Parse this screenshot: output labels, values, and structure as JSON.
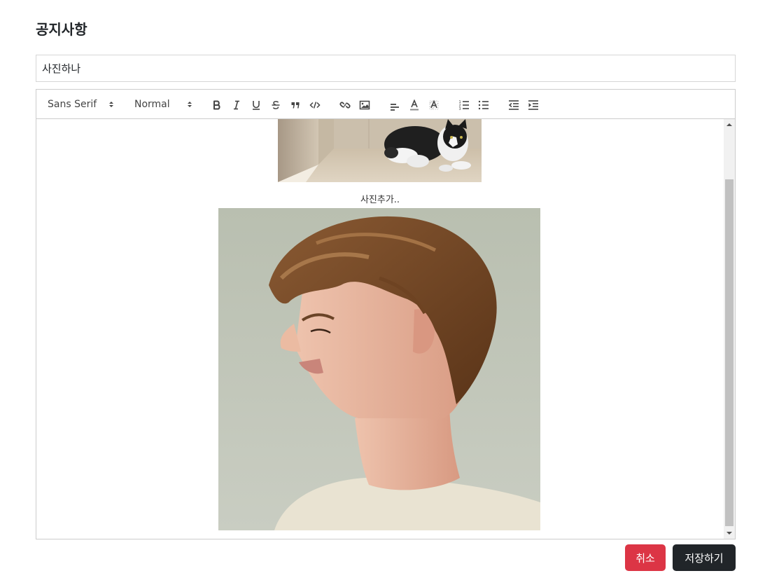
{
  "page": {
    "title": "공지사항"
  },
  "post": {
    "title_value": "사진하나"
  },
  "toolbar": {
    "font_picker": "Sans Serif",
    "size_picker": "Normal",
    "buttons": [
      {
        "icon": "bold-icon"
      },
      {
        "icon": "italic-icon"
      },
      {
        "icon": "underline-icon"
      },
      {
        "icon": "strikethrough-icon"
      },
      {
        "icon": "blockquote-icon"
      },
      {
        "icon": "code-block-icon"
      },
      {
        "icon": "link-icon"
      },
      {
        "icon": "image-icon"
      },
      {
        "icon": "align-icon"
      },
      {
        "icon": "text-color-icon"
      },
      {
        "icon": "background-color-icon"
      },
      {
        "icon": "ordered-list-icon"
      },
      {
        "icon": "bullet-list-icon"
      },
      {
        "icon": "outdent-icon"
      },
      {
        "icon": "indent-icon"
      }
    ]
  },
  "content": {
    "caption": "사진추가..",
    "images": [
      {
        "subject": "black and white cat lying in a cardboard box"
      },
      {
        "subject": "side profile portrait of a young man with brown hair"
      }
    ]
  },
  "buttons": {
    "cancel_label": "취소",
    "save_label": "저장하기",
    "cancel_color": "#dc3545",
    "save_color": "#212529"
  }
}
